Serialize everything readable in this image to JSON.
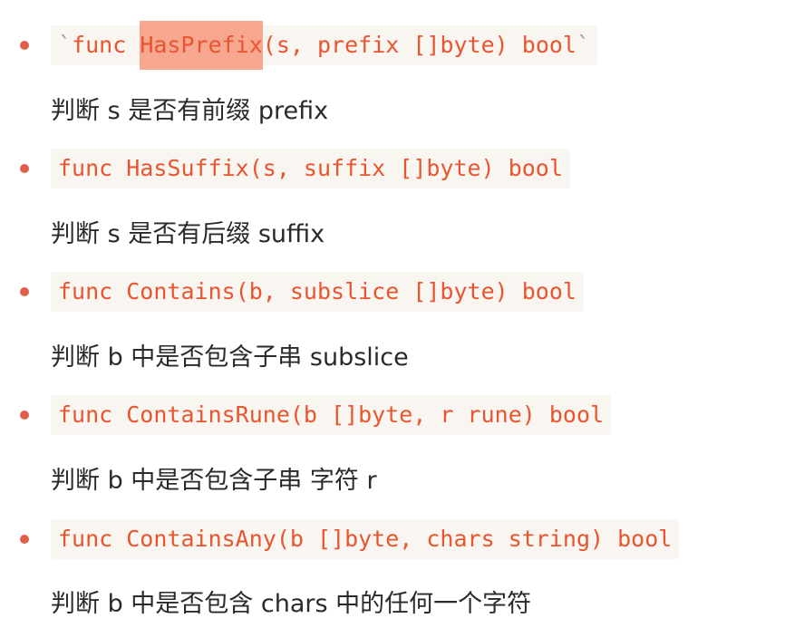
{
  "items": [
    {
      "tick_open": "`",
      "code_pre": "func ",
      "code_highlight": "HasPrefix",
      "code_post": "(s, prefix []byte) bool",
      "tick_close": "`",
      "description": "判断 s 是否有前缀 prefix"
    },
    {
      "code": "func HasSuffix(s, suffix []byte) bool",
      "description": "判断 s 是否有后缀 suffix"
    },
    {
      "code": "func Contains(b, subslice []byte) bool",
      "description": "判断 b 中是否包含子串 subslice"
    },
    {
      "code": "func ContainsRune(b []byte, r rune) bool",
      "description": "判断 b 中是否包含子串 字符 r"
    },
    {
      "code": "func ContainsAny(b []byte, chars string) bool",
      "description": "判断 b 中是否包含 chars 中的任何一个字符"
    }
  ],
  "colors": {
    "bullet": "#e0604b",
    "code_text": "#e8552e",
    "code_background": "#f9f5f1",
    "highlight": "#f7a78f",
    "body_text": "#2a2a2a"
  }
}
